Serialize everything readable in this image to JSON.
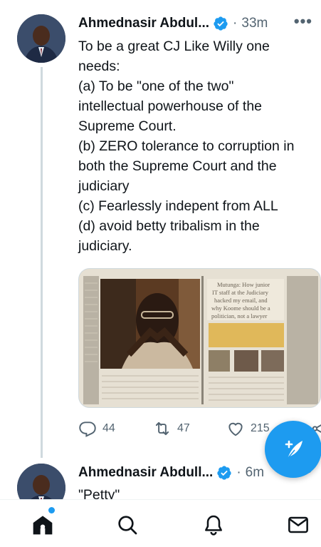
{
  "tweets": [
    {
      "author": "Ahmednasir Abdul...",
      "verified": true,
      "separator": "·",
      "time": "33m",
      "more_label": "•••",
      "lines": [
        "To be a great CJ Like Willy one",
        "needs:",
        "(a) To be \"one of the two\"",
        "intellectual powerhouse of the",
        "Supreme Court.",
        "(b) ZERO tolerance to corruption in",
        "both the Supreme Court and the",
        "judiciary",
        "(c) Fearlessly indepent from ALL",
        "(d) avoid betty tribalism in the",
        "judiciary."
      ],
      "media_headline": [
        "Mutunga: How junior",
        "IT staff at the Judiciary",
        "hacked my email, and",
        "why Koome should be a",
        "politician, not a lawyer"
      ],
      "stats": {
        "replies": "44",
        "retweets": "47",
        "likes": "215"
      }
    },
    {
      "author": "Ahmednasir Abdull...",
      "verified": true,
      "separator": "·",
      "time": "6m",
      "more_label": "•••",
      "text": "\"Petty\""
    }
  ],
  "colors": {
    "accent": "#1d9bf0",
    "text": "#0f1419",
    "muted": "#536471",
    "thread_line": "#cfd9de"
  },
  "icons": {
    "compose": "feather-plus-icon",
    "tabs": [
      "home-icon",
      "search-icon",
      "bell-icon",
      "mail-icon"
    ]
  }
}
